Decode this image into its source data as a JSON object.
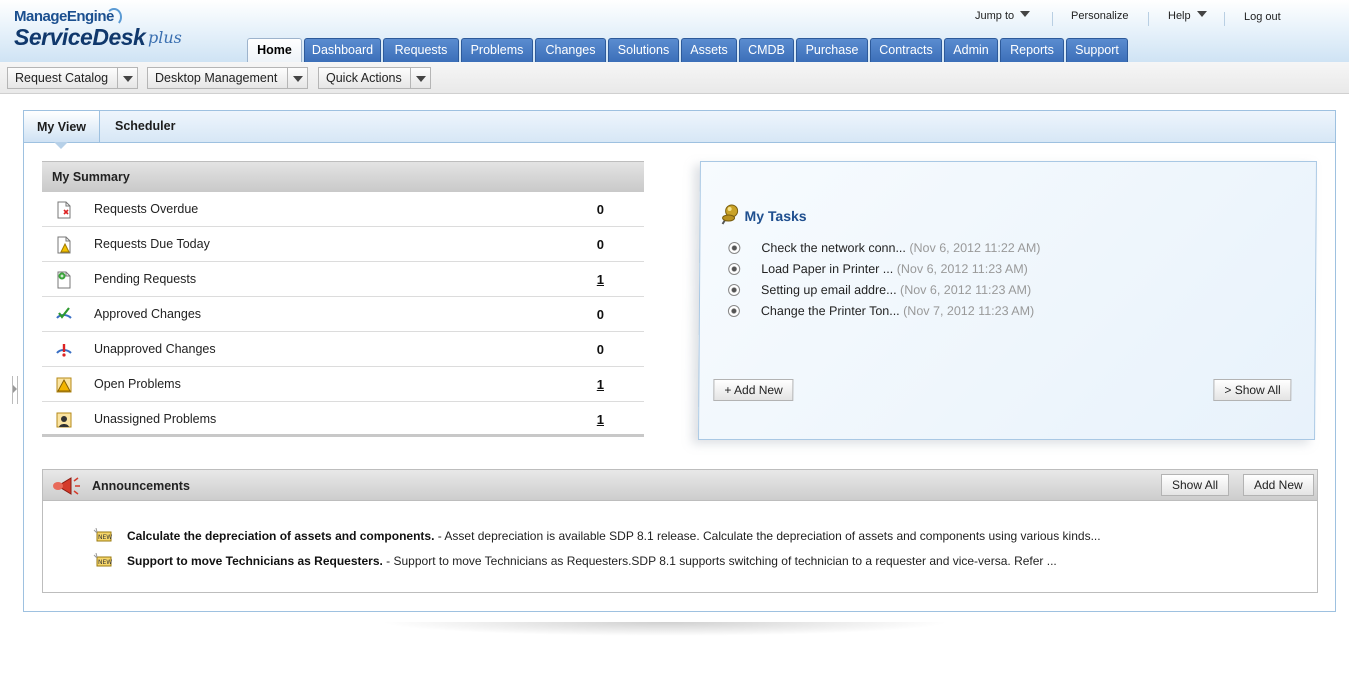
{
  "logo": {
    "brand": "ManageEngine",
    "product": "ServiceDesk",
    "edition": "plus"
  },
  "toplinks": {
    "jump_to": "Jump to",
    "personalize": "Personalize",
    "help": "Help",
    "logout": "Log out"
  },
  "nav": {
    "tabs": [
      "Home",
      "Dashboard",
      "Requests",
      "Problems",
      "Changes",
      "Solutions",
      "Assets",
      "CMDB",
      "Purchase",
      "Contracts",
      "Admin",
      "Reports",
      "Support"
    ],
    "active": "Home"
  },
  "subbar": {
    "request_catalog": "Request Catalog",
    "desktop_management": "Desktop Management",
    "quick_actions": "Quick Actions"
  },
  "view_tabs": {
    "my_view": "My View",
    "scheduler": "Scheduler"
  },
  "summary": {
    "title": "My Summary",
    "rows": [
      {
        "label": "Requests Overdue",
        "value": "0",
        "icon": "overdue-request-icon"
      },
      {
        "label": "Requests Due Today",
        "value": "0",
        "icon": "due-today-icon"
      },
      {
        "label": "Pending Requests",
        "value": "1",
        "icon": "pending-request-icon"
      },
      {
        "label": "Approved Changes",
        "value": "0",
        "icon": "approved-change-icon"
      },
      {
        "label": "Unapproved Changes",
        "value": "0",
        "icon": "unapproved-change-icon"
      },
      {
        "label": "Open Problems",
        "value": "1",
        "icon": "open-problem-icon"
      },
      {
        "label": "Unassigned Problems",
        "value": "1",
        "icon": "unassigned-problem-icon"
      }
    ]
  },
  "tasks": {
    "title": "My Tasks",
    "items": [
      {
        "title": "Check the network conn...",
        "date": "(Nov 6, 2012 11:22 AM)"
      },
      {
        "title": "Load Paper in Printer ...",
        "date": "(Nov 6, 2012 11:23 AM)"
      },
      {
        "title": "Setting up email addre...",
        "date": "(Nov 6, 2012 11:23 AM)"
      },
      {
        "title": "Change the Printer Ton...",
        "date": "(Nov 7, 2012 11:23 AM)"
      }
    ],
    "add_new": "+ Add New",
    "show_all": "> Show All"
  },
  "announcements": {
    "title": "Announcements",
    "show_all": "Show All",
    "add_new": "Add New",
    "items": [
      {
        "title": "Calculate the depreciation of assets and components.",
        "text": " - Asset depreciation is available SDP 8.1 release. Calculate the depreciation of assets and components using various kinds..."
      },
      {
        "title": "Support to move Technicians as Requesters.",
        "text": " - Support to move Technicians as Requesters.SDP 8.1 supports switching of technician to a requester and vice-versa. Refer ..."
      }
    ]
  },
  "colors": {
    "nav_blue": "#3c6fb9",
    "panel_border": "#9ec1e0",
    "task_title": "#1f4f8f"
  }
}
